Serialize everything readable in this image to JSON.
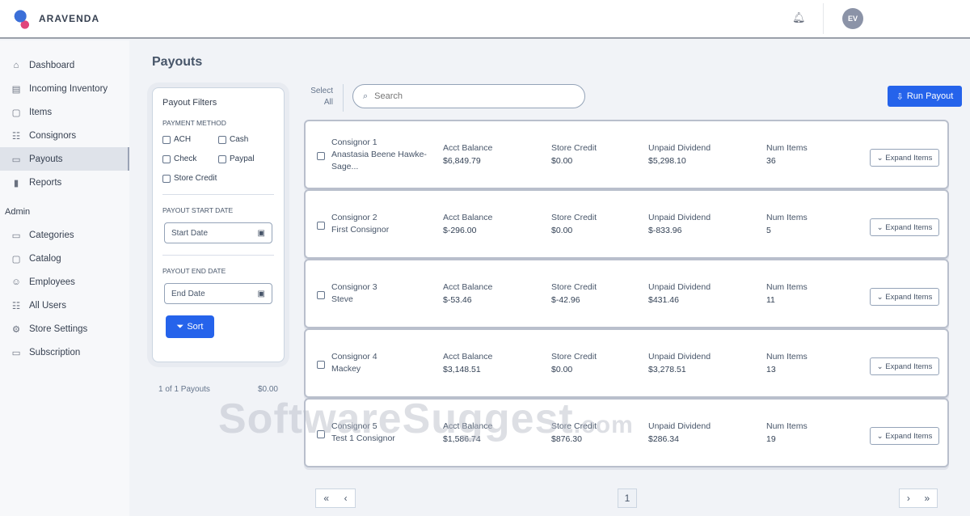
{
  "brand": "ARAVENDA",
  "user": {
    "initials": "EV"
  },
  "sidebar": {
    "items": [
      {
        "label": "Dashboard",
        "icon": "⌂"
      },
      {
        "label": "Incoming Inventory",
        "icon": "▤"
      },
      {
        "label": "Items",
        "icon": "▢"
      },
      {
        "label": "Consignors",
        "icon": "☷"
      },
      {
        "label": "Payouts",
        "icon": "▭"
      },
      {
        "label": "Reports",
        "icon": "▮"
      }
    ],
    "admin_label": "Admin",
    "admin_items": [
      {
        "label": "Categories",
        "icon": "▭"
      },
      {
        "label": "Catalog",
        "icon": "▢"
      },
      {
        "label": "Employees",
        "icon": "☺"
      },
      {
        "label": "All Users",
        "icon": "☷"
      },
      {
        "label": "Store Settings",
        "icon": "⚙"
      },
      {
        "label": "Subscription",
        "icon": "▭"
      }
    ]
  },
  "page_title": "Payouts",
  "filters": {
    "title": "Payout Filters",
    "method_label": "Payment Method",
    "methods": [
      "ACH",
      "Cash",
      "Check",
      "Paypal",
      "Store Credit"
    ],
    "start_label": "Payout Start Date",
    "start_placeholder": "Start Date",
    "end_label": "Payout End Date",
    "end_placeholder": "End Date",
    "sort": "Sort"
  },
  "summary": {
    "count": "1 of 1 Payouts",
    "total": "$0.00"
  },
  "toolbar": {
    "select_all": "Select All",
    "search_placeholder": "Search",
    "run_payout": "Run Payout"
  },
  "columns": {
    "balance": "Acct Balance",
    "credit": "Store Credit",
    "dividend": "Unpaid Dividend",
    "items": "Num Items",
    "expand": "Expand Items"
  },
  "consignors": [
    {
      "id": "Consignor 1",
      "name": "Anastasia Beene Hawke-Sage...",
      "balance": "$6,849.79",
      "credit": "$0.00",
      "dividend": "$5,298.10",
      "items": "36"
    },
    {
      "id": "Consignor 2",
      "name": "First Consignor",
      "balance": "$-296.00",
      "credit": "$0.00",
      "dividend": "$-833.96",
      "items": "5"
    },
    {
      "id": "Consignor 3",
      "name": "Steve",
      "balance": "$-53.46",
      "credit": "$-42.96",
      "dividend": "$431.46",
      "items": "11"
    },
    {
      "id": "Consignor 4",
      "name": "Mackey",
      "balance": "$3,148.51",
      "credit": "$0.00",
      "dividend": "$3,278.51",
      "items": "13"
    },
    {
      "id": "Consignor 5",
      "name": "Test 1 Consignor",
      "balance": "$1,586.74",
      "credit": "$876.30",
      "dividend": "$286.34",
      "items": "19"
    }
  ],
  "pagination": {
    "first": "«",
    "prev": "‹",
    "page": "1",
    "next": "›",
    "last": "»"
  },
  "watermark": {
    "text": "SoftwareSuggest",
    ".com": ".com"
  }
}
